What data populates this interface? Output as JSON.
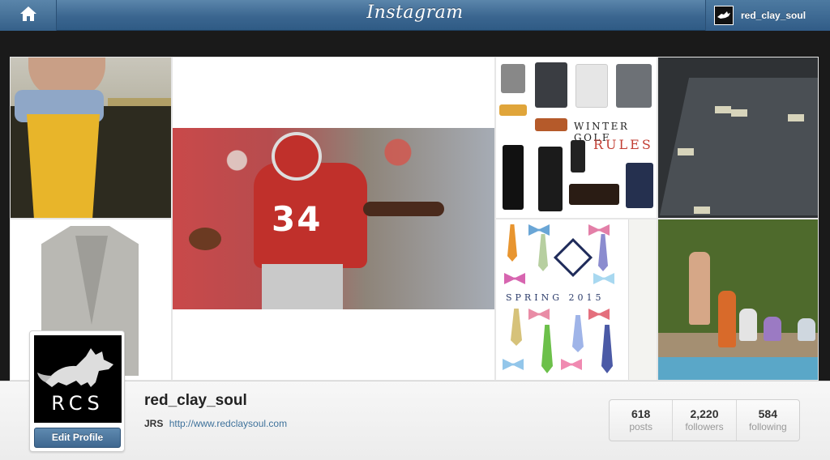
{
  "app": {
    "brand": "Instagram",
    "username": "red_clay_soul"
  },
  "icons": {
    "home": "home-icon",
    "fox_logo": "fox-logo-icon"
  },
  "colors": {
    "topbar": "#3b6690",
    "link": "#3f729b",
    "edit_button": "#4a74a0"
  },
  "grid": {
    "tiles": [
      {
        "id": "tile-1",
        "alt": "sweater and jacket"
      },
      {
        "id": "tile-2",
        "alt": "plaid blazer"
      },
      {
        "id": "tile-3",
        "alt": "football player 34",
        "text": "34"
      },
      {
        "id": "tile-4",
        "alt": "winter golf collage",
        "title": "WINTER GOLF",
        "subtitle": "RULES"
      },
      {
        "id": "tile-5",
        "alt": "spring 2015 ties",
        "title": "SPRING 2015"
      },
      {
        "id": "tile-6",
        "alt": "card table"
      },
      {
        "id": "tile-7",
        "alt": "pool party"
      }
    ]
  },
  "profile": {
    "avatar_text": "RCS",
    "edit_button": "Edit Profile",
    "name": "red_clay_soul",
    "bio_name": "JRS",
    "website": "http://www.redclaysoul.com"
  },
  "stats": [
    {
      "value": "618",
      "label": "posts"
    },
    {
      "value": "2,220",
      "label": "followers"
    },
    {
      "value": "584",
      "label": "following"
    }
  ]
}
